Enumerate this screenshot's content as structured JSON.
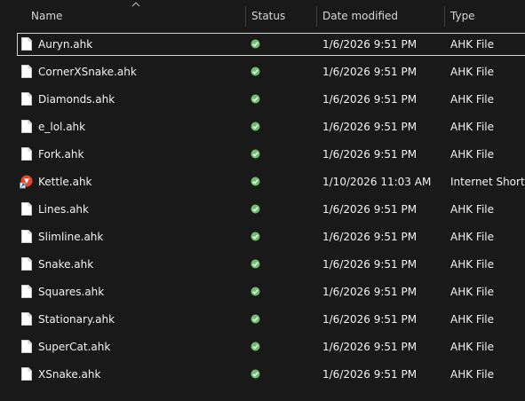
{
  "columns": {
    "name": "Name",
    "status": "Status",
    "date": "Date modified",
    "type": "Type"
  },
  "colors": {
    "background": "#191919",
    "status_ok": "#6cbf6c",
    "selection_border": "#d2d2d2"
  },
  "sort_icon": "chevron-up-icon",
  "files": [
    {
      "name": "Auryn.ahk",
      "status": "synced-icon",
      "date": "1/6/2026 9:51 PM",
      "type": "AHK File",
      "icon": "file-icon",
      "selected": true
    },
    {
      "name": "CornerXSnake.ahk",
      "status": "synced-icon",
      "date": "1/6/2026 9:51 PM",
      "type": "AHK File",
      "icon": "file-icon"
    },
    {
      "name": "Diamonds.ahk",
      "status": "synced-icon",
      "date": "1/6/2026 9:51 PM",
      "type": "AHK File",
      "icon": "file-icon"
    },
    {
      "name": "e_lol.ahk",
      "status": "synced-icon",
      "date": "1/6/2026 9:51 PM",
      "type": "AHK File",
      "icon": "file-icon"
    },
    {
      "name": "Fork.ahk",
      "status": "synced-icon",
      "date": "1/6/2026 9:51 PM",
      "type": "AHK File",
      "icon": "file-icon"
    },
    {
      "name": "Kettle.ahk",
      "status": "synced-icon",
      "date": "1/10/2026 11:03 AM",
      "type": "Internet Shortcu",
      "icon": "internet-shortcut-icon"
    },
    {
      "name": "Lines.ahk",
      "status": "synced-icon",
      "date": "1/6/2026 9:51 PM",
      "type": "AHK File",
      "icon": "file-icon"
    },
    {
      "name": "Slimline.ahk",
      "status": "synced-icon",
      "date": "1/6/2026 9:51 PM",
      "type": "AHK File",
      "icon": "file-icon"
    },
    {
      "name": "Snake.ahk",
      "status": "synced-icon",
      "date": "1/6/2026 9:51 PM",
      "type": "AHK File",
      "icon": "file-icon"
    },
    {
      "name": "Squares.ahk",
      "status": "synced-icon",
      "date": "1/6/2026 9:51 PM",
      "type": "AHK File",
      "icon": "file-icon"
    },
    {
      "name": "Stationary.ahk",
      "status": "synced-icon",
      "date": "1/6/2026 9:51 PM",
      "type": "AHK File",
      "icon": "file-icon"
    },
    {
      "name": "SuperCat.ahk",
      "status": "synced-icon",
      "date": "1/6/2026 9:51 PM",
      "type": "AHK File",
      "icon": "file-icon"
    },
    {
      "name": "XSnake.ahk",
      "status": "synced-icon",
      "date": "1/6/2026 9:51 PM",
      "type": "AHK File",
      "icon": "file-icon"
    }
  ]
}
